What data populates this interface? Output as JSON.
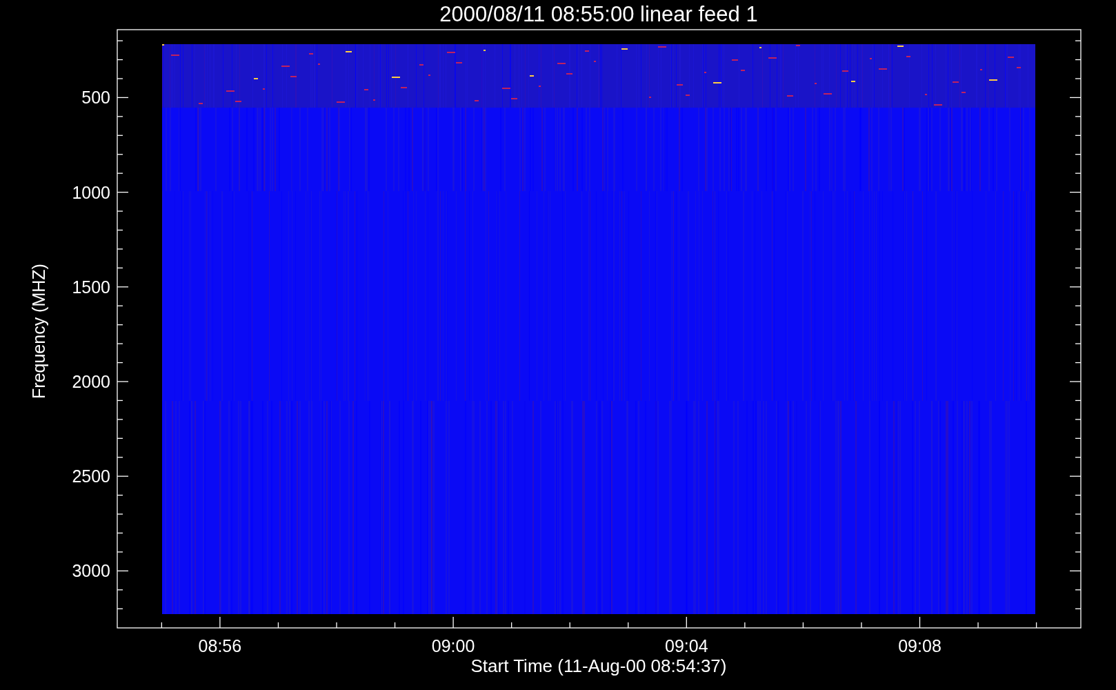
{
  "title": "2000/08/11 08:55:00 linear feed 1",
  "y_axis": {
    "label": "Frequency (MHZ)",
    "ticks": [
      "500",
      "1000",
      "1500",
      "2000",
      "2500",
      "3000"
    ]
  },
  "x_axis": {
    "label": "Start Time (11-Aug-00 08:54:37)",
    "ticks": [
      "08:56",
      "09:00",
      "09:04",
      "09:08"
    ]
  }
}
